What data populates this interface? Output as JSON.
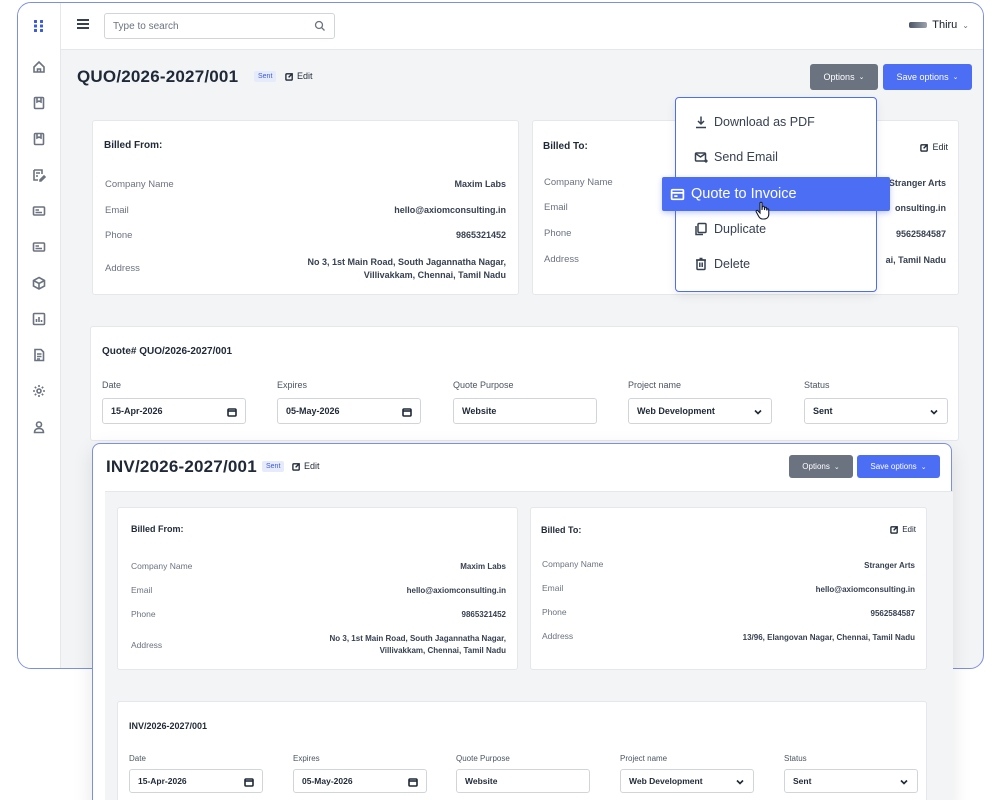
{
  "search": {
    "placeholder": "Type to search"
  },
  "user": {
    "name": "Thiru"
  },
  "quote": {
    "title": "QUO/2026-2027/001",
    "status_badge": "Sent",
    "edit_label": "Edit",
    "options_label": "Options",
    "save_options_label": "Save options",
    "billed_from": {
      "heading": "Billed From:",
      "rows": [
        {
          "label": "Company Name",
          "value": "Maxim Labs"
        },
        {
          "label": "Email",
          "value": "hello@axiomconsulting.in"
        },
        {
          "label": "Phone",
          "value": "9865321452"
        },
        {
          "label": "Address",
          "value_line1": "No 3, 1st Main Road, South Jagannatha Nagar,",
          "value_line2": "Villivakkam, Chennai, Tamil Nadu"
        }
      ]
    },
    "billed_to": {
      "heading": "Billed To:",
      "edit_label": "Edit",
      "rows": [
        {
          "label": "Company Name",
          "value": "Stranger Arts"
        },
        {
          "label": "Email",
          "value": "onsulting.in"
        },
        {
          "label": "Phone",
          "value": "9562584587"
        },
        {
          "label": "Address",
          "value": "ai, Tamil Nadu"
        }
      ]
    },
    "meta": {
      "heading": "Quote# QUO/2026-2027/001",
      "fields": [
        {
          "label": "Date",
          "value": "15-Apr-2026",
          "icon": "calendar-icon"
        },
        {
          "label": "Expires",
          "value": "05-May-2026",
          "icon": "calendar-icon"
        },
        {
          "label": "Quote Purpose",
          "value": "Website"
        },
        {
          "label": "Project name",
          "value": "Web Development",
          "icon": "chevron-down-icon"
        },
        {
          "label": "Status",
          "value": "Sent",
          "icon": "chevron-down-icon"
        }
      ]
    }
  },
  "options_menu": {
    "items": [
      {
        "label": "Download as PDF",
        "icon": "download-icon"
      },
      {
        "label": "Send Email",
        "icon": "mail-send-icon"
      },
      {
        "label": "Quote to Invoice",
        "icon": "invoice-icon",
        "highlighted": true
      },
      {
        "label": "Duplicate",
        "icon": "copy-icon"
      },
      {
        "label": "Delete",
        "icon": "trash-icon"
      }
    ]
  },
  "invoice": {
    "title": "INV/2026-2027/001",
    "status_badge": "Sent",
    "edit_label": "Edit",
    "options_label": "Options",
    "save_options_label": "Save options",
    "billed_from": {
      "heading": "Billed From:",
      "rows": [
        {
          "label": "Company Name",
          "value": "Maxim Labs"
        },
        {
          "label": "Email",
          "value": "hello@axiomconsulting.in"
        },
        {
          "label": "Phone",
          "value": "9865321452"
        },
        {
          "label": "Address",
          "value_line1": "No 3, 1st Main Road, South Jagannatha Nagar,",
          "value_line2": "Villivakkam, Chennai, Tamil Nadu"
        }
      ]
    },
    "billed_to": {
      "heading": "Billed To:",
      "edit_label": "Edit",
      "rows": [
        {
          "label": "Company Name",
          "value": "Stranger Arts"
        },
        {
          "label": "Email",
          "value": "hello@axiomconsulting.in"
        },
        {
          "label": "Phone",
          "value": "9562584587"
        },
        {
          "label": "Address",
          "value": "13/96, Elangovan Nagar, Chennai, Tamil Nadu"
        }
      ]
    },
    "meta": {
      "heading": "INV/2026-2027/001",
      "fields": [
        {
          "label": "Date",
          "value": "15-Apr-2026",
          "icon": "calendar-icon"
        },
        {
          "label": "Expires",
          "value": "05-May-2026",
          "icon": "calendar-icon"
        },
        {
          "label": "Quote Purpose",
          "value": "Website"
        },
        {
          "label": "Project name",
          "value": "Web Development",
          "icon": "chevron-down-icon"
        },
        {
          "label": "Status",
          "value": "Sent",
          "icon": "chevron-down-icon"
        }
      ]
    }
  },
  "colors": {
    "accent": "#4c6ef5",
    "options_button": "#6b7280",
    "frame_border": "#7c8fe0",
    "badge_bg": "#e6ebfb"
  }
}
